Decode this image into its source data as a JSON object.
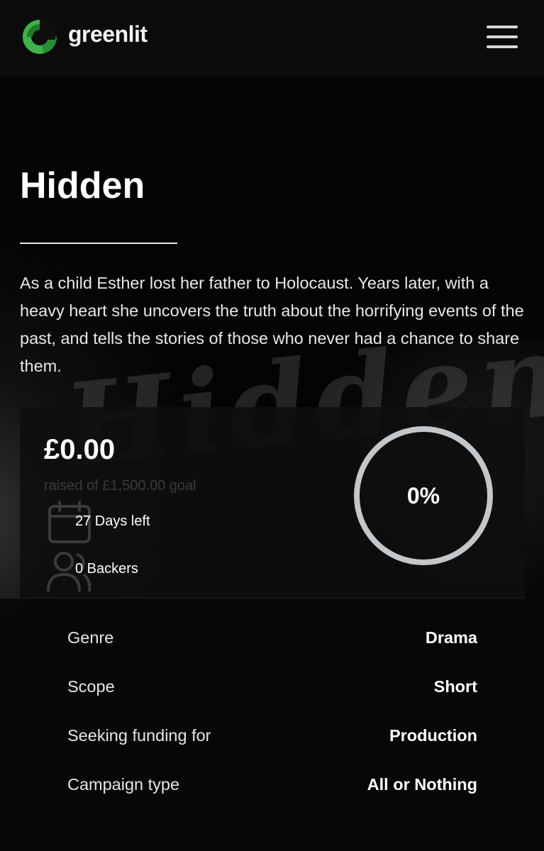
{
  "header": {
    "brand": "greenlit",
    "logo_icon": "greenlit-logo-icon",
    "menu_icon": "hamburger-menu-icon",
    "brand_color": "#3fb24a"
  },
  "project": {
    "title": "Hidden",
    "description": "As a child Esther lost her father to Holocaust. Years later, with a heavy heart she uncovers the truth about the horrifying events of the past, and tells the stories of those who never had a chance to share them."
  },
  "funding": {
    "raised": "£0.00",
    "goal_text": "raised of £1,500.00 goal",
    "days_left": "27 Days left",
    "backers": "0 Backers",
    "progress_label": "0%",
    "progress_fraction": 0,
    "calendar_icon": "calendar-icon",
    "backers_icon": "users-icon"
  },
  "details": [
    {
      "label": "Genre",
      "value": "Drama"
    },
    {
      "label": "Scope",
      "value": "Short"
    },
    {
      "label": "Seeking funding for",
      "value": "Production"
    },
    {
      "label": "Campaign type",
      "value": "All or Nothing"
    }
  ]
}
